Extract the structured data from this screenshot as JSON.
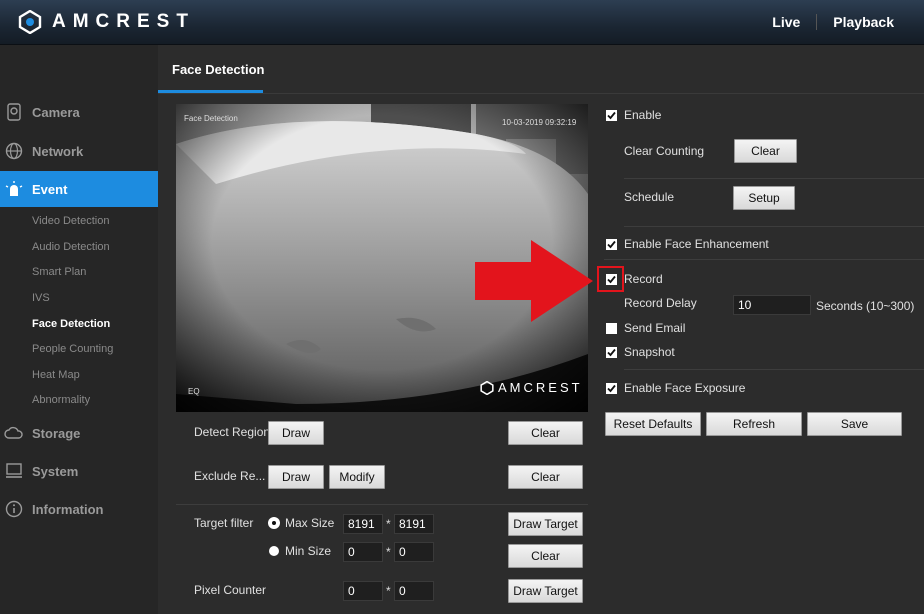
{
  "brand": {
    "name": "AMCREST"
  },
  "topnav": {
    "live": "Live",
    "playback": "Playback"
  },
  "sidebar": {
    "camera": "Camera",
    "network": "Network",
    "event": "Event",
    "event_items": [
      "Video Detection",
      "Audio Detection",
      "Smart Plan",
      "IVS",
      "Face Detection",
      "People Counting",
      "Heat Map",
      "Abnormality"
    ],
    "storage": "Storage",
    "system": "System",
    "information": "Information"
  },
  "tab": {
    "label": "Face Detection"
  },
  "video": {
    "osd_title": "Face Detection",
    "osd_time": "10-03-2019 09:32:19",
    "watermark": "AMCREST",
    "corner": "EQ"
  },
  "left": {
    "detect_region": "Detect Region",
    "exclude_region": "Exclude Re...",
    "draw": "Draw",
    "modify": "Modify",
    "clear": "Clear",
    "target_filter": "Target filter",
    "max_size": "Max Size",
    "min_size": "Min Size",
    "max_w": "8191",
    "max_h": "8191",
    "min_w": "0",
    "min_h": "0",
    "star": "*",
    "draw_target": "Draw Target",
    "pixel_counter": "Pixel Counter",
    "pix_w": "0",
    "pix_h": "0"
  },
  "right": {
    "enable": "Enable",
    "clear_counting": "Clear Counting",
    "clear": "Clear",
    "schedule": "Schedule",
    "setup": "Setup",
    "enable_face_enhancement": "Enable Face Enhancement",
    "record": "Record",
    "record_delay": "Record Delay",
    "record_delay_value": "10",
    "seconds_range": "Seconds (10~300)",
    "send_email": "Send Email",
    "snapshot": "Snapshot",
    "enable_face_exposure": "Enable Face Exposure",
    "reset_defaults": "Reset Defaults",
    "refresh": "Refresh",
    "save": "Save"
  },
  "checkboxes": {
    "enable": true,
    "face_enhancement": true,
    "record": true,
    "send_email": false,
    "snapshot": true,
    "face_exposure": true
  },
  "colors": {
    "accent": "#1d8ce0",
    "annotation": "#e3141c"
  }
}
